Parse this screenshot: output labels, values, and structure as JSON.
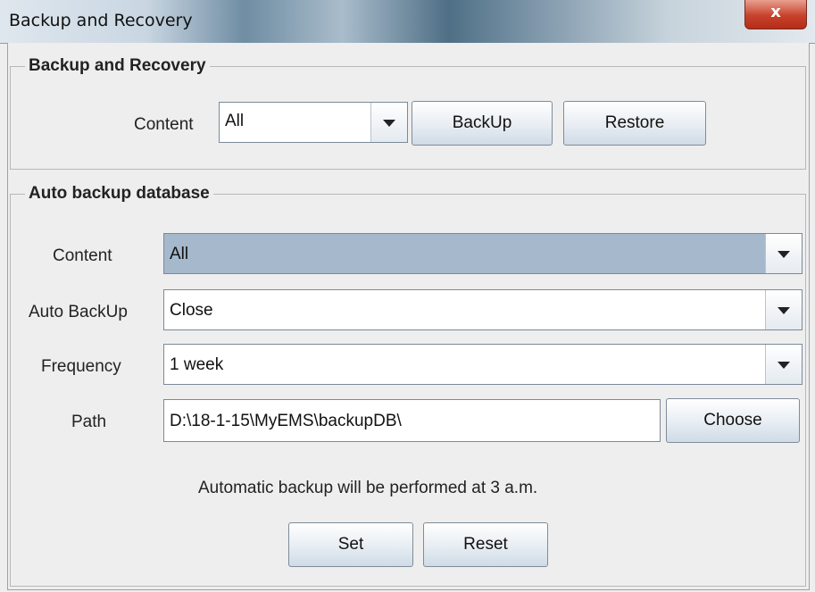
{
  "window": {
    "title": "Backup and Recovery",
    "close_label": "x"
  },
  "backup_group": {
    "title": "Backup and Recovery",
    "content_label": "Content",
    "content_value": "All",
    "backup_label": "BackUp",
    "restore_label": "Restore"
  },
  "auto_group": {
    "title": "Auto backup database",
    "content_label": "Content",
    "content_value": "All",
    "auto_label": "Auto BackUp",
    "auto_value": "Close",
    "frequency_label": "Frequency",
    "frequency_value": "1 week",
    "path_label": "Path",
    "path_value": "D:\\18-1-15\\MyEMS\\backupDB\\",
    "choose_label": "Choose",
    "info_text": "Automatic backup will be performed at 3 a.m.",
    "set_label": "Set",
    "reset_label": "Reset"
  },
  "icons": {
    "dropdown": "chevron-down-icon",
    "close": "close-icon"
  }
}
